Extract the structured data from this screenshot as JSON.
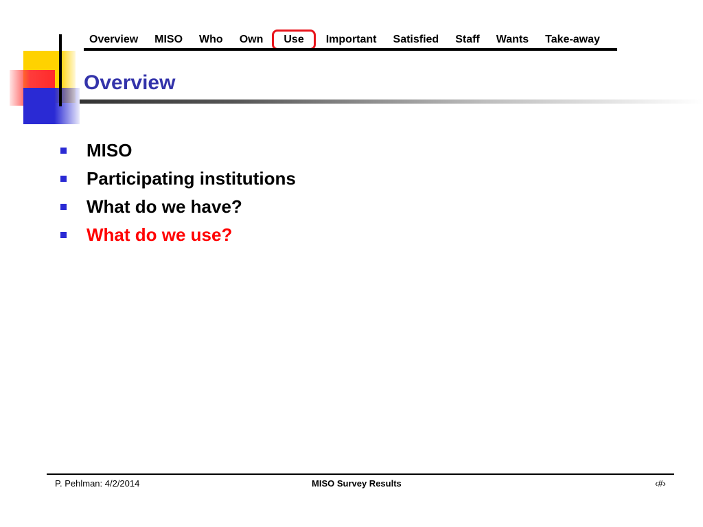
{
  "nav": {
    "items": [
      {
        "label": "Overview"
      },
      {
        "label": "MISO"
      },
      {
        "label": "Who"
      },
      {
        "label": "Own"
      },
      {
        "label": "Use",
        "active": true
      },
      {
        "label": "Important"
      },
      {
        "label": "Satisfied"
      },
      {
        "label": "Staff"
      },
      {
        "label": "Wants"
      },
      {
        "label": "Take-away"
      }
    ]
  },
  "slide": {
    "title": "Overview",
    "bullets": [
      {
        "text": "MISO"
      },
      {
        "text": "Participating institutions"
      },
      {
        "text": "What do we have?"
      },
      {
        "text": "What do we use?",
        "highlighted": true
      }
    ]
  },
  "footer": {
    "left": "P. Pehlman: 4/2/2014",
    "center": "MISO Survey Results",
    "right": "‹#›"
  },
  "colors": {
    "title": "#3333aa",
    "highlight": "#ff0000",
    "active_outline": "#e8141b",
    "bullet": "#2a2ad4",
    "accent_yellow": "#ffd200",
    "accent_red": "#ff2a2a",
    "accent_blue": "#2a2ad4"
  }
}
